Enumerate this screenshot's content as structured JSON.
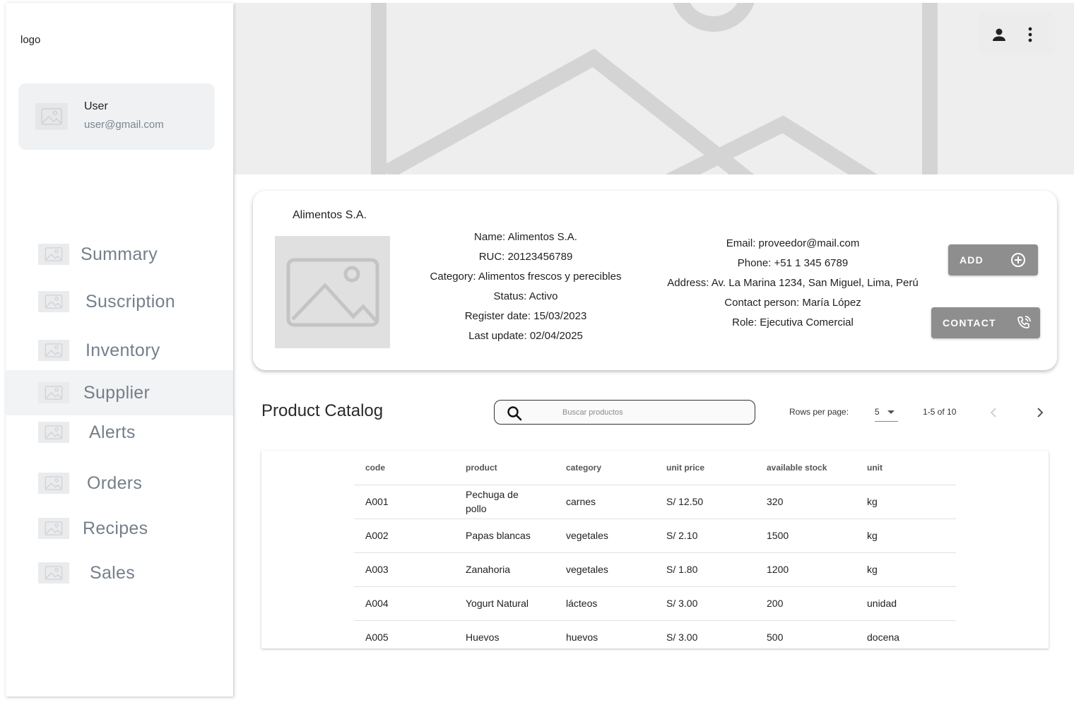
{
  "sidebar": {
    "logo": "logo",
    "user": {
      "name": "User",
      "email": "user@gmail.com"
    },
    "items": [
      {
        "label": "Summary",
        "icon": "image-placeholder-icon"
      },
      {
        "label": "Suscription",
        "icon": "image-placeholder-icon"
      },
      {
        "label": "Inventory",
        "icon": "image-placeholder-icon"
      },
      {
        "label": "Supplier",
        "icon": "image-placeholder-icon",
        "active": true
      },
      {
        "label": "Alerts",
        "icon": "image-placeholder-icon"
      },
      {
        "label": "Orders",
        "icon": "image-placeholder-icon"
      },
      {
        "label": "Recipes",
        "icon": "image-placeholder-icon"
      },
      {
        "label": "Sales",
        "icon": "image-placeholder-icon"
      }
    ]
  },
  "header": {
    "actions": [
      {
        "icon": "person-icon"
      },
      {
        "icon": "more-vert-icon"
      }
    ]
  },
  "supplier": {
    "title": "Alimentos S.A.",
    "details": [
      "Name: Alimentos S.A.",
      "RUC: 20123456789",
      "Category: Alimentos frescos y perecibles",
      "Status: Activo",
      "Register date: 15/03/2023",
      "Last update: 02/04/2025"
    ],
    "contact": [
      "Email: proveedor@mail.com",
      "Phone: +51 1 345 6789",
      "Address: Av. La Marina 1234, San Miguel, Lima, Perú",
      "Contact person: María López",
      "Role: Ejecutiva Comercial"
    ],
    "add_label": "ADD",
    "contact_label": "CONTACT"
  },
  "catalog": {
    "title": "Product Catalog",
    "search_placeholder": "Buscar productos",
    "rows_per_page_label": "Rows per page:",
    "rows_per_page_value": "5",
    "range": "1-5 of 10",
    "columns": [
      "code",
      "product",
      "category",
      "unit price",
      "available stock",
      "unit"
    ],
    "rows": [
      [
        "A001",
        "Pechuga de pollo",
        "carnes",
        "S/ 12.50",
        "320",
        "kg"
      ],
      [
        "A002",
        "Papas blancas",
        "vegetales",
        "S/ 2.10",
        "1500",
        "kg"
      ],
      [
        "A003",
        "Zanahoria",
        "vegetales",
        "S/ 1.80",
        "1200",
        "kg"
      ],
      [
        "A004",
        "Yogurt Natural",
        "lácteos",
        "S/ 3.00",
        "200",
        "unidad"
      ],
      [
        "A005",
        "Huevos",
        "huevos",
        "S/ 3.00",
        "500",
        "docena"
      ]
    ]
  },
  "colors": {
    "button_bg": "#8e8e8e",
    "nav_text": "#747f8b",
    "active_bg": "#f2f3f4"
  }
}
